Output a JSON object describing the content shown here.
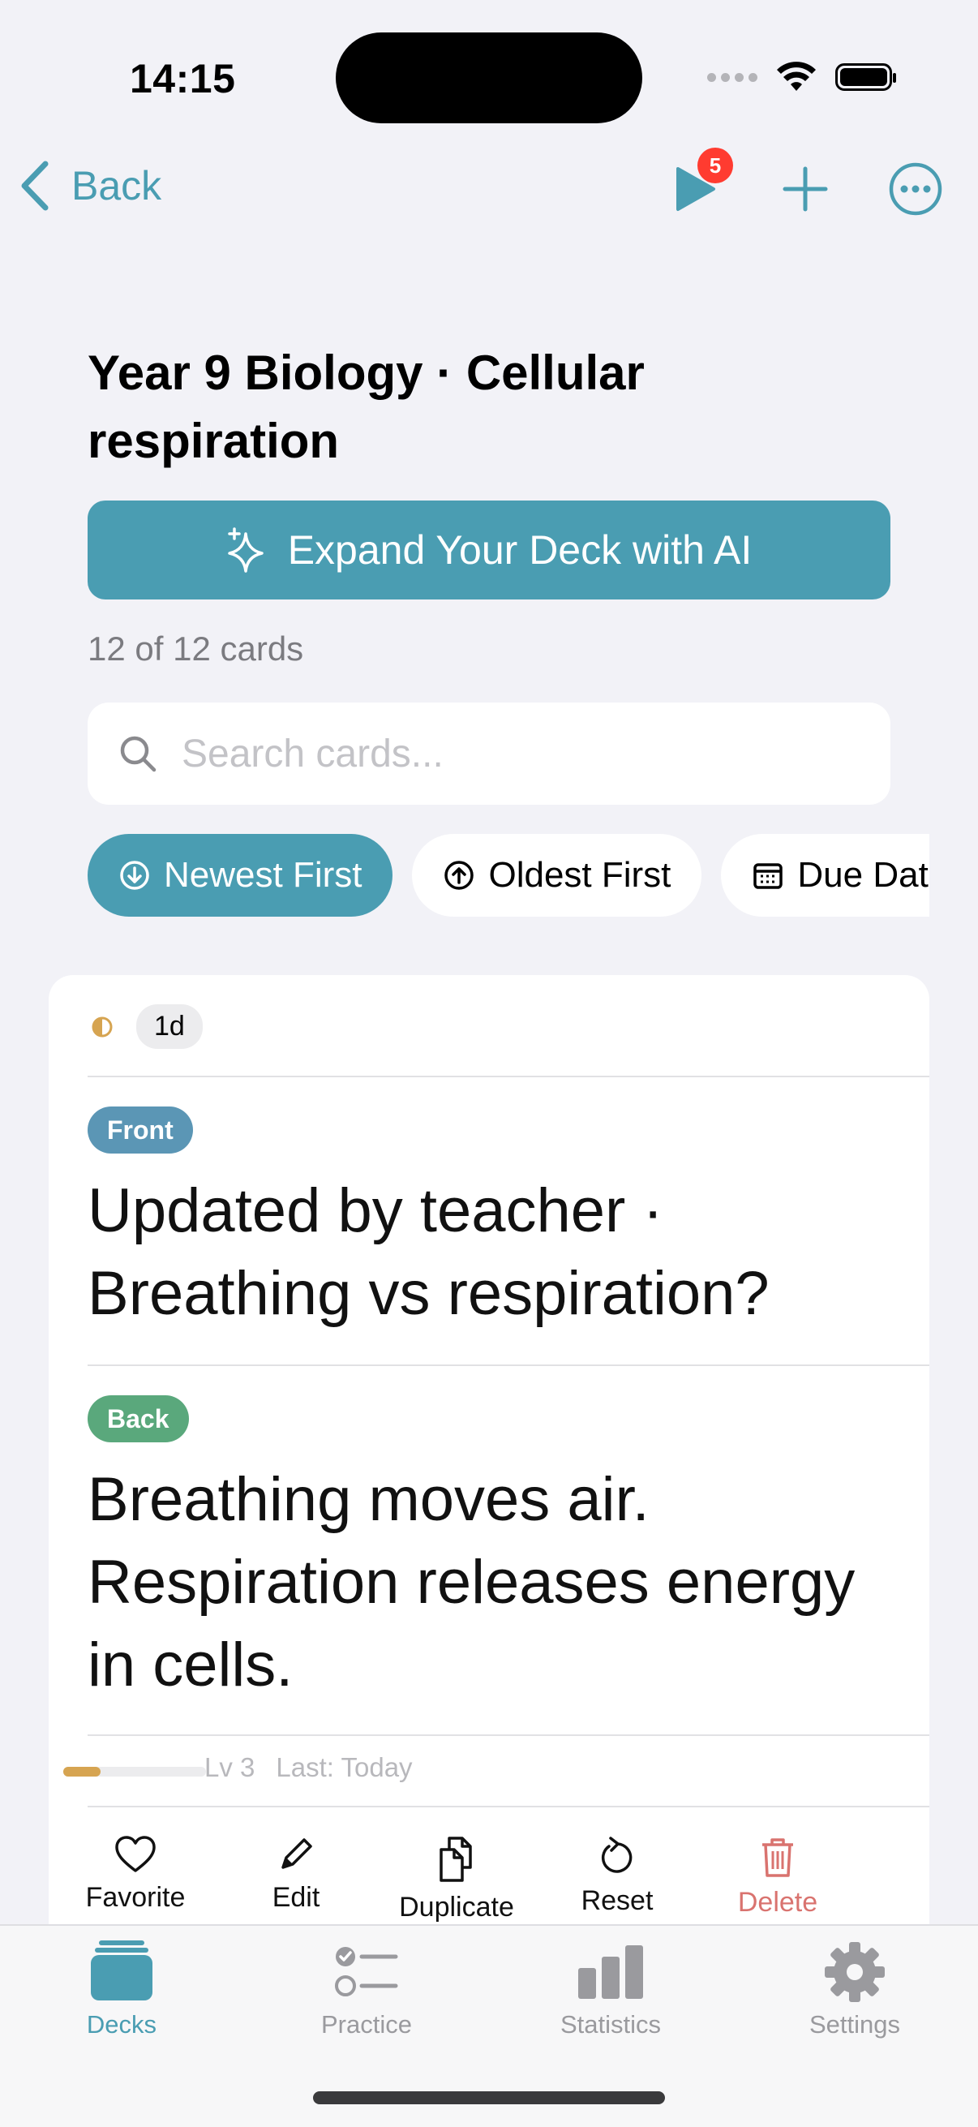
{
  "status_bar": {
    "time": "14:15"
  },
  "nav": {
    "back_label": "Back",
    "play_badge": "5"
  },
  "deck": {
    "title": "Year 9 Biology · Cellular respiration",
    "ai_button_label": "Expand Your Deck with AI",
    "card_count": "12 of 12 cards"
  },
  "search": {
    "placeholder": "Search cards..."
  },
  "sort_chips": [
    {
      "label": "Newest First",
      "active": true
    },
    {
      "label": "Oldest First",
      "active": false
    },
    {
      "label": "Due Date",
      "active": false
    }
  ],
  "card": {
    "due": "1d",
    "front_label": "Front",
    "front_text": "Updated by teacher · Breathing vs respiration?",
    "back_label": "Back",
    "back_text": "Breathing moves air. Respiration releases energy in cells.",
    "level": "Lv 3",
    "last": "Last: Today",
    "progress_fraction": 0.26,
    "actions": {
      "favorite": "Favorite",
      "edit": "Edit",
      "duplicate": "Duplicate",
      "reset": "Reset",
      "delete": "Delete"
    }
  },
  "tabs": [
    {
      "label": "Decks",
      "active": true
    },
    {
      "label": "Practice",
      "active": false
    },
    {
      "label": "Statistics",
      "active": false
    },
    {
      "label": "Settings",
      "active": false
    }
  ],
  "colors": {
    "accent": "#4a9db2",
    "front_tag": "#5b96b5",
    "back_tag": "#5aa87c",
    "delete": "#d9736f",
    "badge": "#ff3b30"
  }
}
